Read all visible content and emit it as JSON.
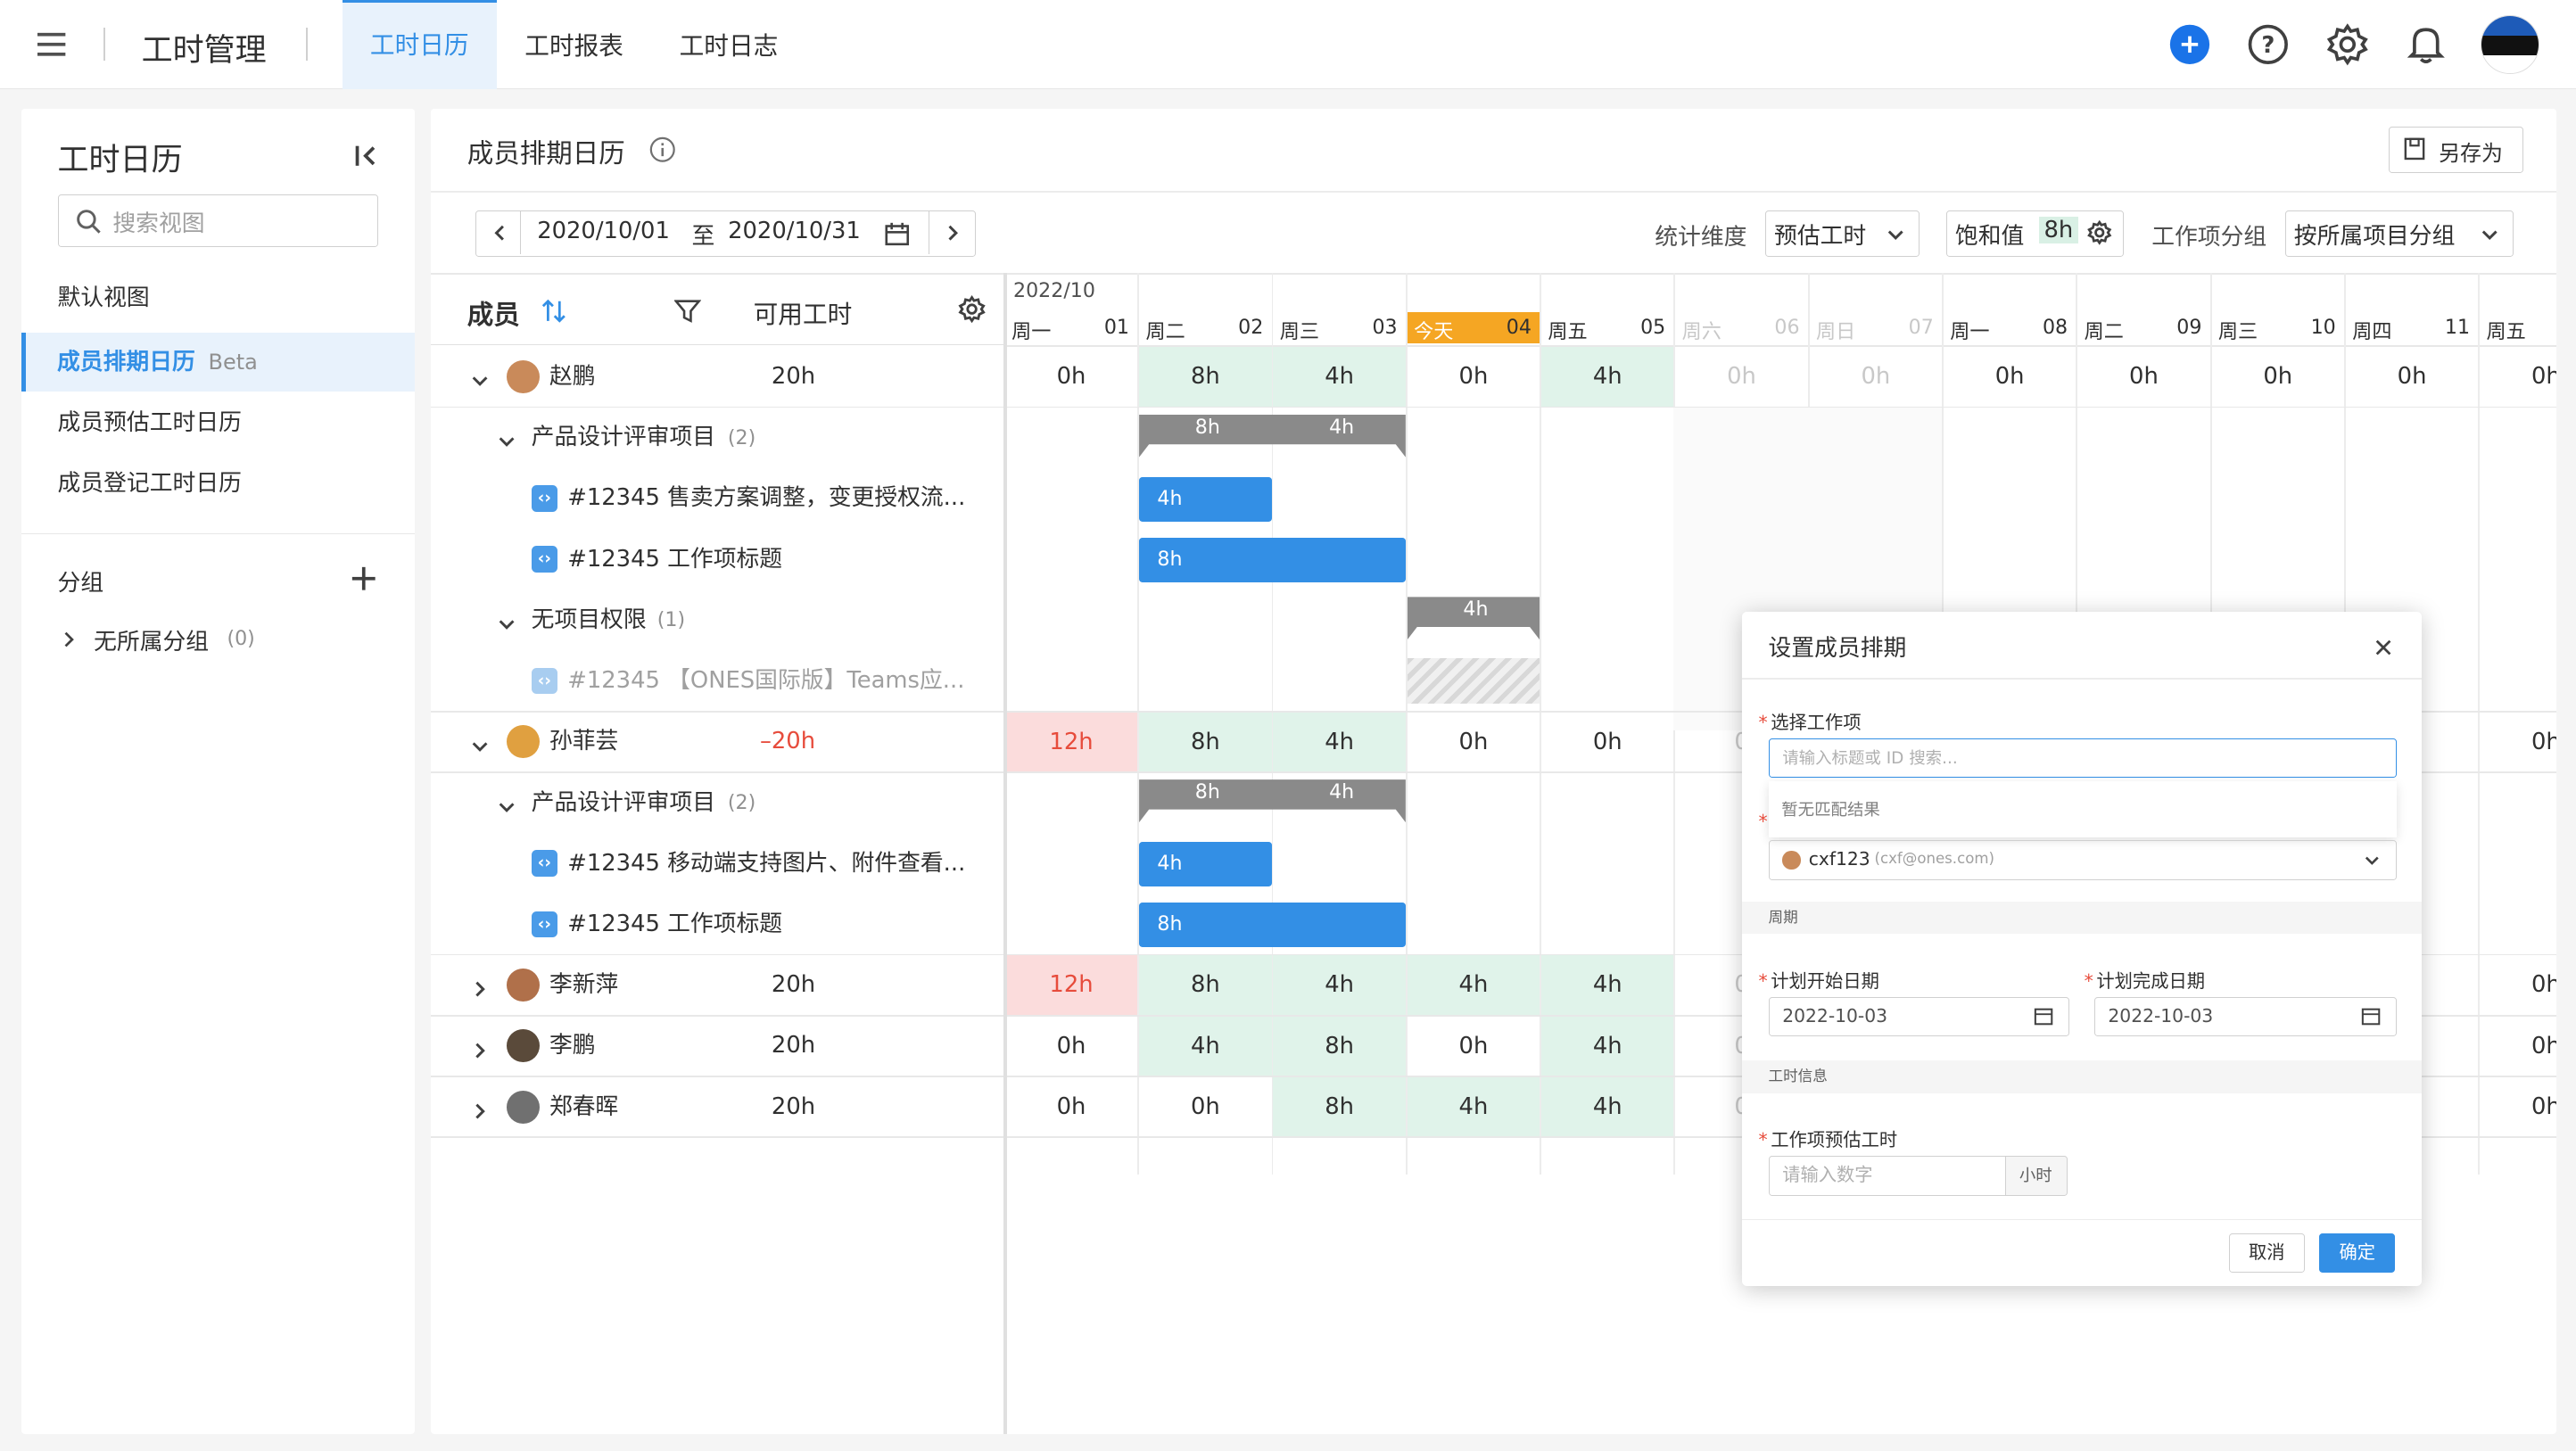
{
  "header": {
    "app_title": "工时管理",
    "tabs": [
      {
        "label": "工时日历",
        "active": true
      },
      {
        "label": "工时报表",
        "active": false
      },
      {
        "label": "工时日志",
        "active": false
      }
    ],
    "accent_color": "#338fe5"
  },
  "sidebar": {
    "title": "工时日历",
    "search_placeholder": "搜索视图",
    "default_view_title": "默认视图",
    "items": [
      {
        "label": "成员排期日历",
        "badge": "Beta",
        "active": true
      },
      {
        "label": "成员预估工时日历",
        "active": false
      },
      {
        "label": "成员登记工时日历",
        "active": false
      }
    ],
    "group_title": "分组",
    "groups": [
      {
        "label": "无所属分组",
        "count": "(0)"
      }
    ]
  },
  "main": {
    "title": "成员排期日历",
    "save_as_label": "另存为",
    "date_range": {
      "start": "2020/10/01",
      "sep": "至",
      "end": "2020/10/31"
    },
    "stat_dim_label": "统计维度",
    "stat_dim_value": "预估工时",
    "saturation_label": "饱和值",
    "saturation_value": "8h",
    "group_by_label": "工作项分组",
    "group_by_value": "按所属项目分组",
    "col_member": "成员",
    "col_available": "可用工时",
    "month_label": "2022/10",
    "days": [
      {
        "wd": "周一",
        "d": "01",
        "weekend": false,
        "today": false
      },
      {
        "wd": "周二",
        "d": "02",
        "weekend": false,
        "today": false
      },
      {
        "wd": "周三",
        "d": "03",
        "weekend": false,
        "today": false
      },
      {
        "wd": "今天",
        "d": "04",
        "weekend": false,
        "today": true
      },
      {
        "wd": "周五",
        "d": "05",
        "weekend": false,
        "today": false
      },
      {
        "wd": "周六",
        "d": "06",
        "weekend": true,
        "today": false
      },
      {
        "wd": "周日",
        "d": "07",
        "weekend": true,
        "today": false
      },
      {
        "wd": "周一",
        "d": "08",
        "weekend": false,
        "today": false
      },
      {
        "wd": "周二",
        "d": "09",
        "weekend": false,
        "today": false
      },
      {
        "wd": "周三",
        "d": "10",
        "weekend": false,
        "today": false
      },
      {
        "wd": "周四",
        "d": "11",
        "weekend": false,
        "today": false
      },
      {
        "wd": "周五",
        "d": "",
        "weekend": false,
        "today": false
      }
    ],
    "members": [
      {
        "name": "赵鹏",
        "available": "20h",
        "negative": false,
        "expanded": true,
        "cells": [
          "0h",
          "8h",
          "4h",
          "0h",
          "4h",
          "0h",
          "0h",
          "0h",
          "0h",
          "0h",
          "0h",
          "0h"
        ],
        "styles": [
          "",
          "g",
          "g",
          "",
          "g",
          "d",
          "d",
          "",
          "",
          "",
          "",
          ""
        ],
        "projects": [
          {
            "name": "产品设计评审项目",
            "count": "(2)",
            "sum": [
              "8h",
              "4h"
            ],
            "items": [
              {
                "title": "#12345 售卖方案调整，变更授权流...",
                "bar": "4h",
                "muted": false
              },
              {
                "title": "#12345 工作项标题",
                "bar": "8h",
                "muted": false
              }
            ]
          },
          {
            "name": "无项目权限",
            "count": "(1)",
            "sum": [
              "4h"
            ],
            "items": [
              {
                "title": "#12345 【ONES国际版】Teams应...",
                "bar": "",
                "muted": true
              }
            ]
          }
        ]
      },
      {
        "name": "孙菲芸",
        "available": "–20h",
        "negative": true,
        "expanded": true,
        "cells": [
          "12h",
          "8h",
          "4h",
          "0h",
          "0h",
          "0",
          "",
          "",
          "",
          "",
          "",
          "0h"
        ],
        "styles": [
          "r",
          "g",
          "g",
          "",
          "",
          "d",
          "",
          "",
          "",
          "",
          "",
          ""
        ],
        "projects": [
          {
            "name": "产品设计评审项目",
            "count": "(2)",
            "sum": [
              "8h",
              "4h"
            ],
            "items": [
              {
                "title": "#12345 移动端支持图片、附件查看...",
                "bar": "4h",
                "muted": false
              },
              {
                "title": "#12345 工作项标题",
                "bar": "8h",
                "muted": false
              }
            ]
          }
        ]
      },
      {
        "name": "李新萍",
        "available": "20h",
        "negative": false,
        "expanded": false,
        "cells": [
          "12h",
          "8h",
          "4h",
          "4h",
          "4h",
          "0",
          "",
          "",
          "",
          "",
          "",
          "0h"
        ],
        "styles": [
          "r",
          "g",
          "g",
          "g",
          "g",
          "d",
          "",
          "",
          "",
          "",
          "",
          ""
        ]
      },
      {
        "name": "李鹏",
        "available": "20h",
        "negative": false,
        "expanded": false,
        "cells": [
          "0h",
          "4h",
          "8h",
          "0h",
          "4h",
          "0",
          "",
          "",
          "",
          "",
          "",
          "0h"
        ],
        "styles": [
          "",
          "g",
          "g",
          "",
          "g",
          "d",
          "",
          "",
          "",
          "",
          "",
          ""
        ]
      },
      {
        "name": "郑春晖",
        "available": "20h",
        "negative": false,
        "expanded": false,
        "cells": [
          "0h",
          "0h",
          "8h",
          "4h",
          "4h",
          "0",
          "",
          "",
          "",
          "",
          "",
          "0h"
        ],
        "styles": [
          "",
          "",
          "g",
          "g",
          "g",
          "d",
          "",
          "",
          "",
          "",
          "",
          ""
        ]
      }
    ]
  },
  "modal": {
    "title": "设置成员排期",
    "work_item_label": "选择工作项",
    "work_item_placeholder": "请输入标题或 ID 搜索...",
    "no_result": "暂无匹配结果",
    "member_value": "cxf123",
    "member_email": "(cxf@ones.com)",
    "period_section": "周期",
    "start_label": "计划开始日期",
    "start_value": "2022-10-03",
    "end_label": "计划完成日期",
    "end_value": "2022-10-03",
    "hours_section": "工时信息",
    "estimate_label": "工作项预估工时",
    "estimate_placeholder": "请输入数字",
    "estimate_unit": "小时",
    "cancel_label": "取消",
    "confirm_label": "确定"
  }
}
